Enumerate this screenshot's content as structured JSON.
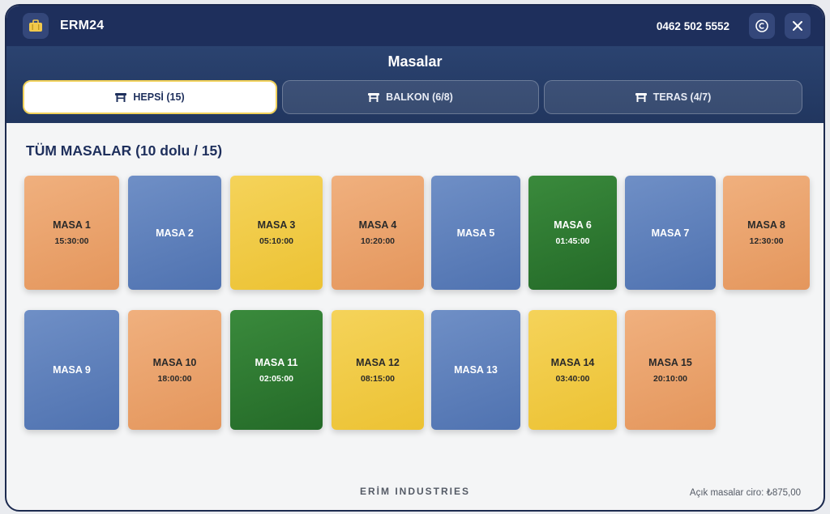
{
  "app": {
    "name": "ERM24",
    "phone": "0462 502 5552"
  },
  "colors": {
    "orange": "#e8a06c",
    "blue": "#5b7dba",
    "yellow": "#f0c942",
    "green": "#2f7a32",
    "navy": "#1e2f5c"
  },
  "icons": {
    "logo": "briefcase-icon",
    "copyright": "copyright-icon",
    "close": "close-icon",
    "tab": "table-icon"
  },
  "header": {
    "title": "Masalar"
  },
  "tabs": [
    {
      "label": "HEPSİ (15)",
      "active": true
    },
    {
      "label": "BALKON (6/8)",
      "active": false
    },
    {
      "label": "TERAS (4/7)",
      "active": false
    }
  ],
  "section": {
    "title": "TÜM MASALAR (10 dolu / 15)"
  },
  "tables": [
    {
      "name": "MASA 1",
      "time": "15:30:00",
      "color": "orange"
    },
    {
      "name": "MASA 2",
      "time": "",
      "color": "blue"
    },
    {
      "name": "MASA 3",
      "time": "05:10:00",
      "color": "yellow"
    },
    {
      "name": "MASA 4",
      "time": "10:20:00",
      "color": "orange"
    },
    {
      "name": "MASA 5",
      "time": "",
      "color": "blue"
    },
    {
      "name": "MASA 6",
      "time": "01:45:00",
      "color": "green"
    },
    {
      "name": "MASA 7",
      "time": "",
      "color": "blue"
    },
    {
      "name": "MASA 8",
      "time": "12:30:00",
      "color": "orange"
    },
    {
      "name": "MASA 9",
      "time": "",
      "color": "blue"
    },
    {
      "name": "MASA 10",
      "time": "18:00:00",
      "color": "orange"
    },
    {
      "name": "MASA 11",
      "time": "02:05:00",
      "color": "green"
    },
    {
      "name": "MASA 12",
      "time": "08:15:00",
      "color": "yellow"
    },
    {
      "name": "MASA 13",
      "time": "",
      "color": "blue"
    },
    {
      "name": "MASA 14",
      "time": "03:40:00",
      "color": "yellow"
    },
    {
      "name": "MASA 15",
      "time": "20:10:00",
      "color": "orange"
    }
  ],
  "footer": {
    "brand": "ERİM INDUSTRIES",
    "ciro": "Açık masalar ciro: ₺875,00"
  }
}
